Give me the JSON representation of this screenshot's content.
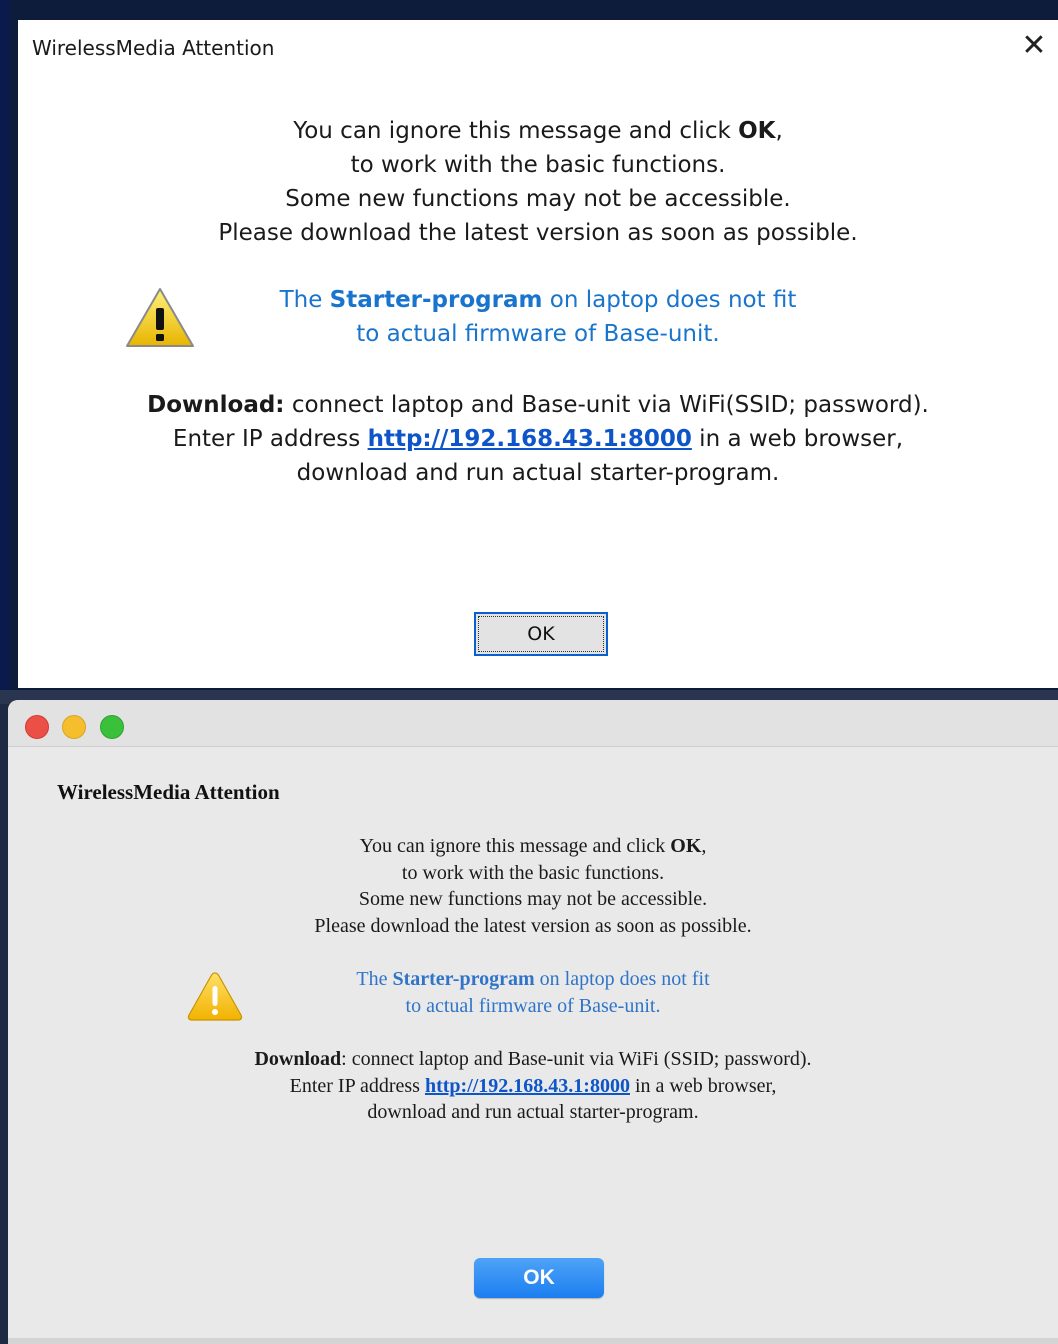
{
  "windows_dialog": {
    "title": "WirelessMedia Attention",
    "close_glyph": "✕",
    "message": {
      "line1_pre": "You can ignore this message and click ",
      "line1_bold": "OK",
      "line1_post": ",",
      "line2": "to work with the basic functions.",
      "line3": "Some new functions may not be accessible.",
      "line4": "Please download the latest version as soon as possible."
    },
    "warning": {
      "icon": "warning-triangle-icon",
      "line1_pre": "The ",
      "line1_bold": "Starter-program",
      "line1_post": " on laptop does not fit",
      "line2": "to actual firmware of Base-unit."
    },
    "download": {
      "label": "Download:",
      "line1_rest": " connect laptop and Base-unit via WiFi(SSID; password).",
      "line2_pre": "Enter IP address ",
      "link": "http://192.168.43.1:8000",
      "line2_post": " in a web browser,",
      "line3": "download and run actual starter-program."
    },
    "ok_label": "OK"
  },
  "mac_dialog": {
    "title": "WirelessMedia Attention",
    "message": {
      "line1_pre": "You can ignore this message and click ",
      "line1_bold": "OK",
      "line1_post": ",",
      "line2": "to work with the basic functions.",
      "line3": "Some new functions may not be accessible.",
      "line4": "Please download the latest version as soon as possible."
    },
    "warning": {
      "icon": "warning-triangle-icon",
      "line1_pre": "The ",
      "line1_bold": "Starter-program",
      "line1_post": " on laptop does not fit",
      "line2": "to actual firmware of Base-unit."
    },
    "download": {
      "label": "Download",
      "line1_rest": ": connect laptop and Base-unit via WiFi (SSID; password).",
      "line2_pre": "Enter IP address ",
      "link": "http://192.168.43.1:8000",
      "line2_post": " in a web browser,",
      "line3": "download and run actual starter-program."
    },
    "ok_label": "OK"
  },
  "colors": {
    "warning_text_win": "#1874cc",
    "warning_text_mac": "#2f74c8",
    "link": "#0d55c8",
    "mac_ok_button": "#1c7ef0",
    "traffic_red": "#ec4f45",
    "traffic_yellow": "#f5be2c",
    "traffic_green": "#3ac03a"
  }
}
